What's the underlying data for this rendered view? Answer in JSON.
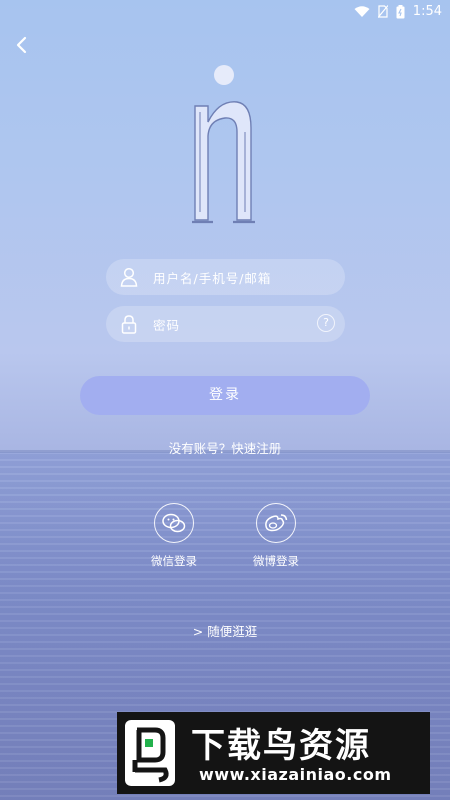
{
  "status_bar": {
    "time": "1:54",
    "icons": [
      "wifi-icon",
      "no-sim-icon",
      "battery-icon"
    ]
  },
  "nav": {
    "back_icon": "chevron-left-icon"
  },
  "logo": {
    "letter": "n",
    "description_icon": "app-logo"
  },
  "form": {
    "username_placeholder": "用户名/手机号/邮箱",
    "password_placeholder": "密码",
    "help_symbol": "?",
    "login_label": "登录",
    "register_text": "没有账号？快速注册"
  },
  "social": {
    "wechat_label": "微信登录",
    "weibo_label": "微博登录"
  },
  "browse_text": "> 随便逛逛",
  "watermark": {
    "title": "下载鸟资源",
    "url": "www.xiazainiao.com"
  },
  "colors": {
    "button": "#a2aef0",
    "text": "#ffffff",
    "watermark_bg": "#141414"
  }
}
